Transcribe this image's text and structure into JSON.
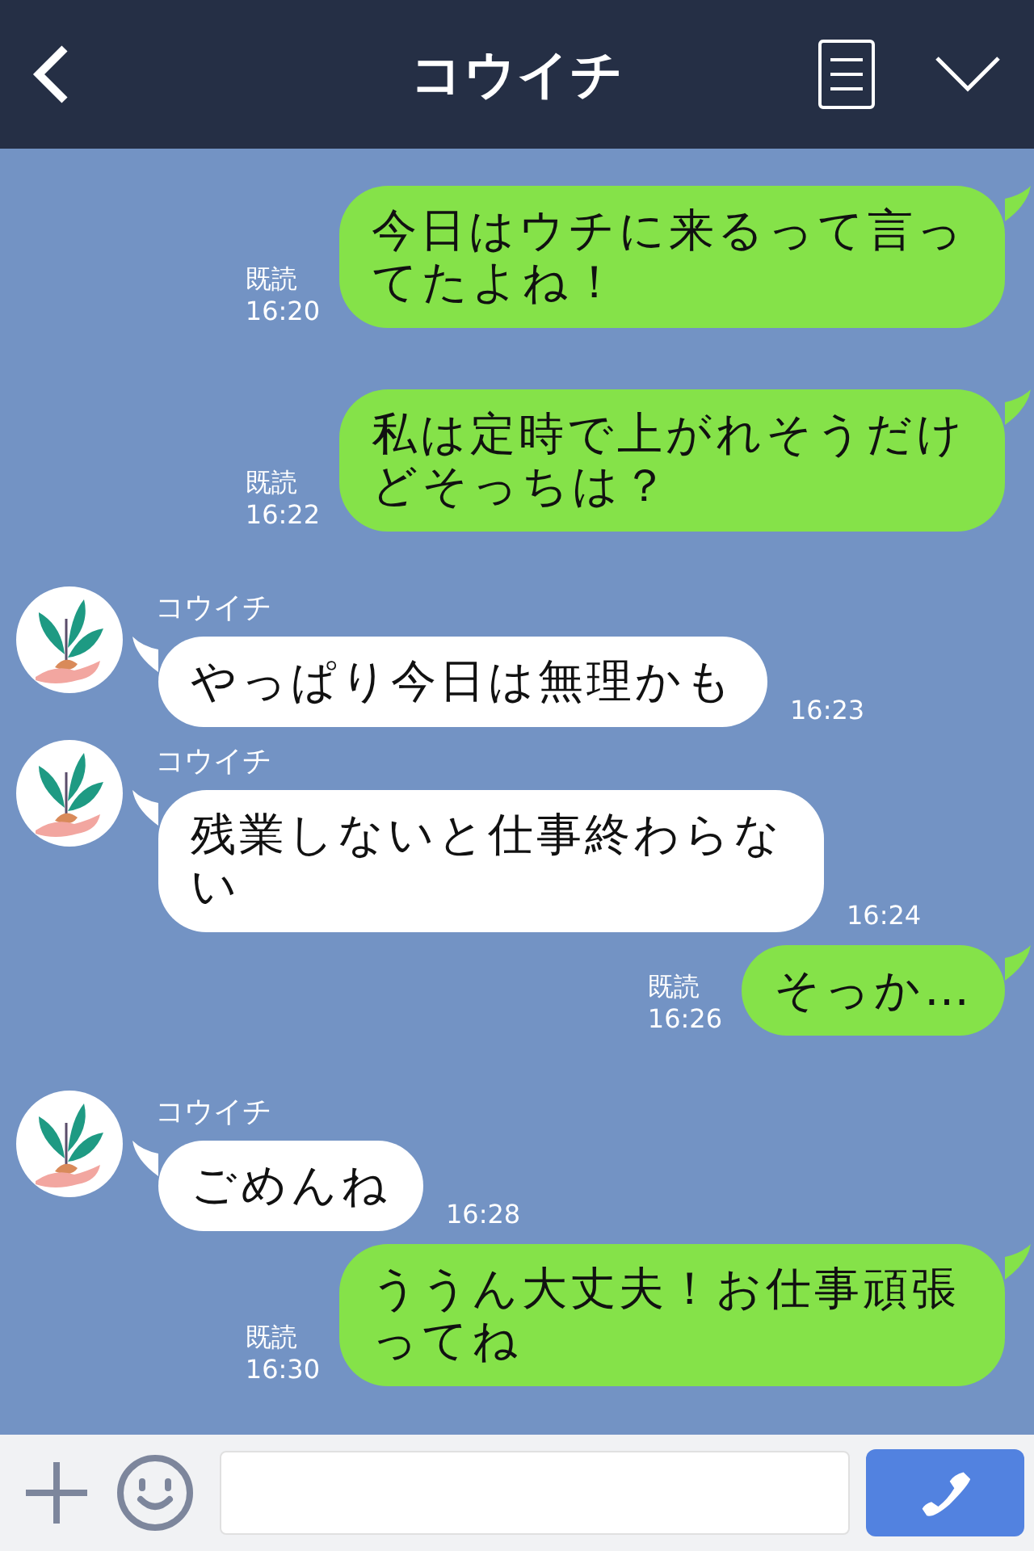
{
  "header": {
    "title": "コウイチ"
  },
  "messages": [
    {
      "kind": "sent",
      "text": "今日はウチに来るって言ってたよね！",
      "read": "既読",
      "time": "16:20"
    },
    {
      "kind": "sent",
      "text": "私は定時で上がれそうだけどそっちは？",
      "read": "既読",
      "time": "16:22"
    },
    {
      "kind": "received",
      "sender": "コウイチ",
      "text": "やっぱり今日は無理かも",
      "time": "16:23"
    },
    {
      "kind": "received",
      "sender": "コウイチ",
      "text": "残業しないと仕事終わらない",
      "time": "16:24"
    },
    {
      "kind": "sent",
      "text": "そっか…",
      "read": "既読",
      "time": "16:26"
    },
    {
      "kind": "received",
      "sender": "コウイチ",
      "text": "ごめんね",
      "time": "16:28"
    },
    {
      "kind": "sent",
      "text": "ううん大丈夫！お仕事頑張ってね",
      "read": "既読",
      "time": "16:30"
    }
  ]
}
